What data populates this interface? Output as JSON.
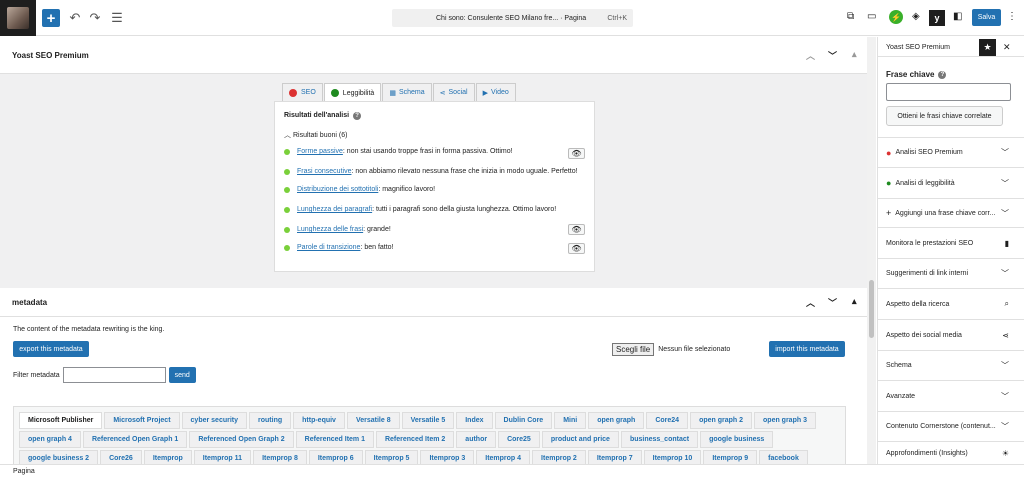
{
  "topbar": {
    "command_title": "Chi sono: Consulente SEO Milano fre... · Pagina",
    "command_shortcut": "Ctrl+K",
    "save_label": "Salva"
  },
  "yoast_panel": {
    "title": "Yoast SEO Premium",
    "tabs": [
      {
        "label": "SEO",
        "icon": "red-face-icon"
      },
      {
        "label": "Leggibilità",
        "icon": "green-face-icon"
      },
      {
        "label": "Schema",
        "icon": "grid-icon"
      },
      {
        "label": "Social",
        "icon": "share-icon"
      },
      {
        "label": "Video",
        "icon": "video-icon"
      }
    ],
    "analysis_heading": "Risultati dell'analisi",
    "good_results_label": "Risultati buoni (6)",
    "results": [
      {
        "link": "Forme passive",
        "text": ": non stai usando troppe frasi in forma passiva. Ottimo!",
        "eye": true
      },
      {
        "link": "Frasi consecutive",
        "text": ": non abbiamo rilevato nessuna frase che inizia in modo uguale. Perfetto!",
        "eye": false
      },
      {
        "link": "Distribuzione dei sottotitoli",
        "text": ": magnifico lavoro!",
        "eye": false
      },
      {
        "link": "Lunghezza dei paragrafi",
        "text": ": tutti i paragrafi sono della giusta lunghezza. Ottimo lavoro!",
        "eye": false
      },
      {
        "link": "Lunghezza delle frasi",
        "text": ": grande!",
        "eye": true
      },
      {
        "link": "Parole di transizione",
        "text": ": ben fatto!",
        "eye": true
      }
    ]
  },
  "metadata": {
    "title": "metadata",
    "description": "The content of the metadata rewriting is the king.",
    "export_label": "export this metadata",
    "file_button": "Scegli file",
    "file_status": "Nessun file selezionato",
    "import_label": "import this metadata",
    "filter_label": "Filter metadata",
    "send_label": "send",
    "tag_rows": [
      [
        "Microsoft Publisher",
        "Microsoft Project",
        "cyber security",
        "routing",
        "http-equiv",
        "Versatile 8",
        "Versatile 5",
        "Index",
        "Dublin Core",
        "Mini",
        "open graph",
        "Core24",
        "open graph 2",
        "open graph 3"
      ],
      [
        "open graph 4",
        "Referenced Open Graph 1",
        "Referenced Open Graph 2",
        "Referenced Item 1",
        "Referenced Item 2",
        "author",
        "Core25",
        "product and price",
        "business_contact",
        "google business"
      ],
      [
        "google business 2",
        "Core26",
        "Itemprop",
        "Itemprop 11",
        "Itemprop 8",
        "Itemprop 6",
        "Itemprop 5",
        "Itemprop 3",
        "Itemprop 4",
        "Itemprop 2",
        "Itemprop 7",
        "Itemprop 10",
        "Itemprop 9",
        "facebook"
      ]
    ]
  },
  "sidebar": {
    "title": "Yoast SEO Premium",
    "keyphrase_label": "Frase chiave",
    "related_button": "Ottieni le frasi chiave correlate",
    "items": [
      {
        "label": "Analisi SEO Premium",
        "icon": "red-face-icon",
        "right": "chevron-down-icon"
      },
      {
        "label": "Analisi di leggibilità",
        "icon": "green-face-icon",
        "right": "chevron-down-icon"
      },
      {
        "label": "Aggiungi una frase chiave corr...",
        "icon": "plus-icon",
        "right": "chevron-down-icon"
      },
      {
        "label": "Monitora le prestazioni SEO",
        "icon": "",
        "right": "bar-chart-icon"
      },
      {
        "label": "Suggerimenti di link interni",
        "icon": "",
        "right": "chevron-down-icon"
      },
      {
        "label": "Aspetto della ricerca",
        "icon": "",
        "right": "search-icon"
      },
      {
        "label": "Aspetto dei social media",
        "icon": "",
        "right": "share-icon"
      },
      {
        "label": "Schema",
        "icon": "",
        "right": "chevron-down-icon"
      },
      {
        "label": "Avanzate",
        "icon": "",
        "right": "chevron-down-icon"
      },
      {
        "label": "Contenuto Cornerstone (contenut...",
        "icon": "",
        "right": "chevron-down-icon"
      },
      {
        "label": "Approfondimenti (Insights)",
        "icon": "",
        "right": "sun-icon"
      }
    ]
  },
  "statusbar": {
    "label": "Pagina"
  }
}
